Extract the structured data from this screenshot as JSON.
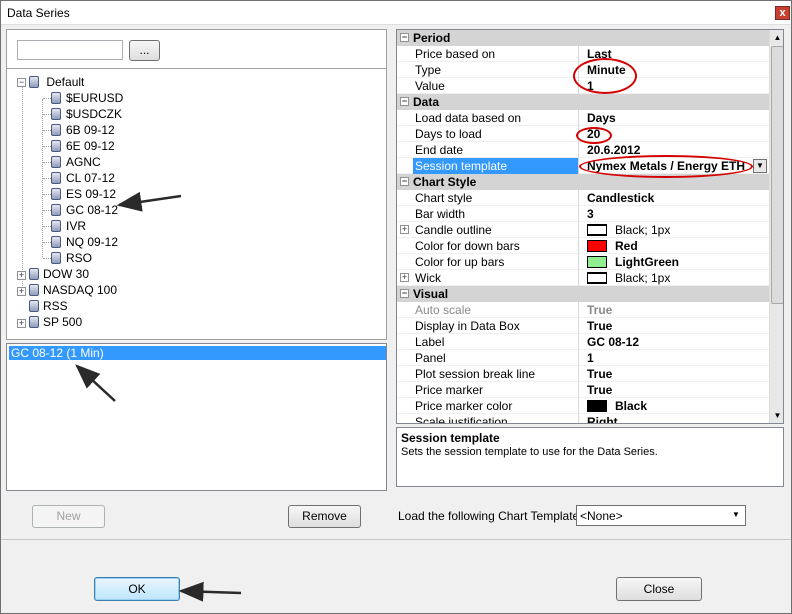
{
  "window": {
    "title": "Data Series",
    "close_glyph": "x"
  },
  "search": {
    "value": "",
    "browse_label": "..."
  },
  "tree": {
    "root": "Default",
    "instruments": [
      "$EURUSD",
      "$USDCZK",
      "6B 09-12",
      "6E 09-12",
      "AGNC",
      "CL 07-12",
      "ES 09-12",
      "GC 08-12",
      "IVR",
      "NQ 09-12",
      "RSO"
    ],
    "groups": [
      "DOW 30",
      "NASDAQ 100",
      "RSS",
      "SP 500"
    ]
  },
  "selected_series": {
    "label": "GC 08-12 (1 Min)"
  },
  "buttons": {
    "new": "New",
    "remove": "Remove",
    "ok": "OK",
    "close": "Close"
  },
  "chart_template": {
    "label": "Load the following Chart Template:",
    "value": "<None>"
  },
  "property_grid": {
    "categories": {
      "period": "Period",
      "data": "Data",
      "chart_style": "Chart Style",
      "visual": "Visual"
    },
    "rows": {
      "price_based_on": {
        "name": "Price based on",
        "value": "Last"
      },
      "type": {
        "name": "Type",
        "value": "Minute"
      },
      "value": {
        "name": "Value",
        "value": "1"
      },
      "load_based_on": {
        "name": "Load data based on",
        "value": "Days"
      },
      "days_to_load": {
        "name": "Days to load",
        "value": "20"
      },
      "end_date": {
        "name": "End date",
        "value": "20.6.2012"
      },
      "session_template": {
        "name": "Session template",
        "value": "Nymex Metals / Energy ETH"
      },
      "chart_style": {
        "name": "Chart style",
        "value": "Candlestick"
      },
      "bar_width": {
        "name": "Bar width",
        "value": "3"
      },
      "candle_outline": {
        "name": "Candle outline",
        "value": "Black; 1px"
      },
      "color_down": {
        "name": "Color for down bars",
        "value": "Red"
      },
      "color_up": {
        "name": "Color for up bars",
        "value": "LightGreen"
      },
      "wick": {
        "name": "Wick",
        "value": "Black; 1px"
      },
      "auto_scale": {
        "name": "Auto scale",
        "value": "True"
      },
      "display_in_data_box": {
        "name": "Display in Data Box",
        "value": "True"
      },
      "label": {
        "name": "Label",
        "value": "GC 08-12"
      },
      "panel": {
        "name": "Panel",
        "value": "1"
      },
      "plot_session_break_line": {
        "name": "Plot session break line",
        "value": "True"
      },
      "price_marker": {
        "name": "Price marker",
        "value": "True"
      },
      "price_marker_color": {
        "name": "Price marker color",
        "value": "Black"
      },
      "scale_justification": {
        "name": "Scale justification",
        "value": "Right"
      }
    }
  },
  "description": {
    "title": "Session template",
    "text": "Sets the session template to use for the Data Series."
  },
  "colors": {
    "selection": "#3399ff",
    "annotation_red": "#d40000",
    "down_bars": "#ff0000",
    "up_bars": "#90ee90",
    "price_marker": "#000000"
  }
}
